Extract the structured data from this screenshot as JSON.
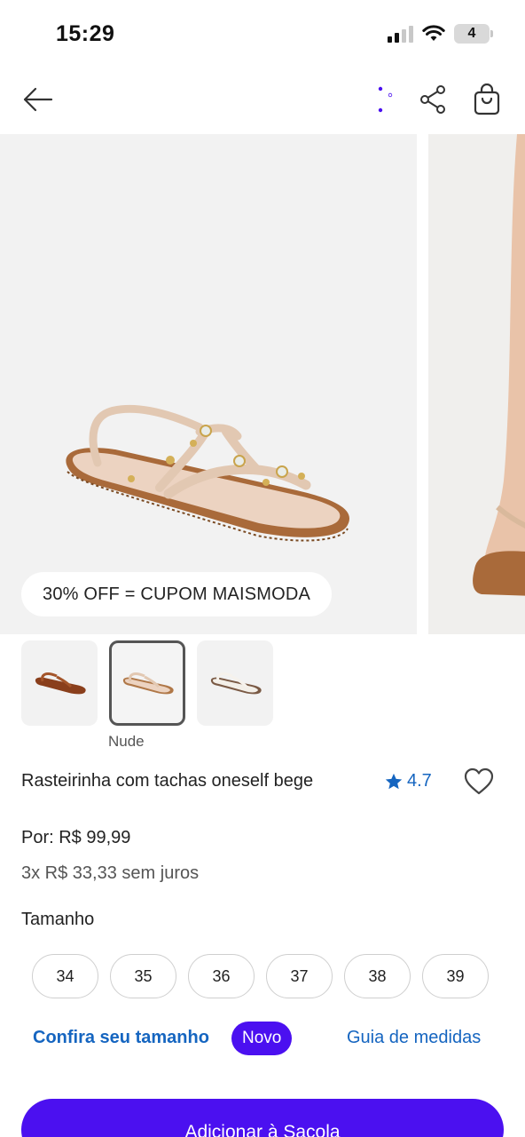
{
  "status_bar": {
    "time": "15:29",
    "battery": "4"
  },
  "nav": {
    "back_icon": "arrow-left-icon",
    "loading_icon": "dots-loader-icon",
    "share_icon": "share-icon",
    "bag_icon": "shopping-bag-icon"
  },
  "gallery": {
    "promo": "30% OFF = CUPOM MAISMODA"
  },
  "thumbnails": {
    "items": [
      {
        "color": "Caramelo"
      },
      {
        "color": "Nude"
      },
      {
        "color": "Off-white"
      }
    ],
    "selected_label": "Nude"
  },
  "product": {
    "title": "Rasteirinha com tachas oneself bege",
    "rating": "4.7",
    "price": "Por: R$ 99,99",
    "installments": "3x R$ 33,33 sem juros"
  },
  "sizes": {
    "heading": "Tamanho",
    "options": [
      "34",
      "35",
      "36",
      "37",
      "38",
      "39"
    ]
  },
  "size_help": {
    "check_label": "Confira seu tamanho",
    "badge": "Novo",
    "guide_label": "Guia de medidas"
  },
  "cta": {
    "label": "Adicionar à Sacola"
  },
  "colors": {
    "accent": "#4b10f0",
    "link": "#1565c0"
  }
}
